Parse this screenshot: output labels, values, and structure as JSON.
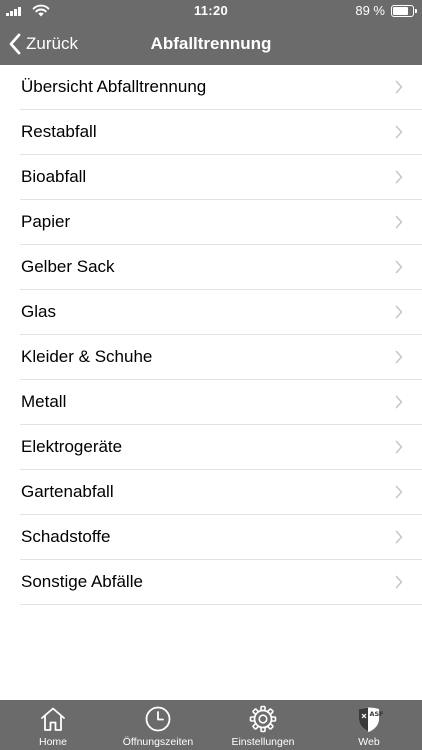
{
  "status_bar": {
    "time": "11:20",
    "battery_text": "89 %",
    "battery_level": 0.89,
    "icons": [
      "signal-icon",
      "wifi-icon",
      "battery-icon"
    ]
  },
  "nav": {
    "back_label": "Zurück",
    "title": "Abfalltrennung"
  },
  "list": {
    "items": [
      {
        "label": "Übersicht Abfalltrennung"
      },
      {
        "label": "Restabfall"
      },
      {
        "label": "Bioabfall"
      },
      {
        "label": "Papier"
      },
      {
        "label": "Gelber Sack"
      },
      {
        "label": "Glas"
      },
      {
        "label": "Kleider & Schuhe"
      },
      {
        "label": "Metall"
      },
      {
        "label": "Elektrogeräte"
      },
      {
        "label": "Gartenabfall"
      },
      {
        "label": "Schadstoffe"
      },
      {
        "label": "Sonstige Abfälle"
      }
    ]
  },
  "tab_bar": {
    "tabs": [
      {
        "label": "Home",
        "icon": "home-icon"
      },
      {
        "label": "Öffnungszeiten",
        "icon": "clock-icon"
      },
      {
        "label": "Einstellungen",
        "icon": "gear-icon"
      },
      {
        "label": "Web",
        "icon": "asf-shield-icon"
      }
    ]
  },
  "colors": {
    "header_bg": "#6b6b6b",
    "tab_bar_bg": "#6b6b6b",
    "separator": "#e2e2e2",
    "chevron": "#c7c7cc"
  }
}
